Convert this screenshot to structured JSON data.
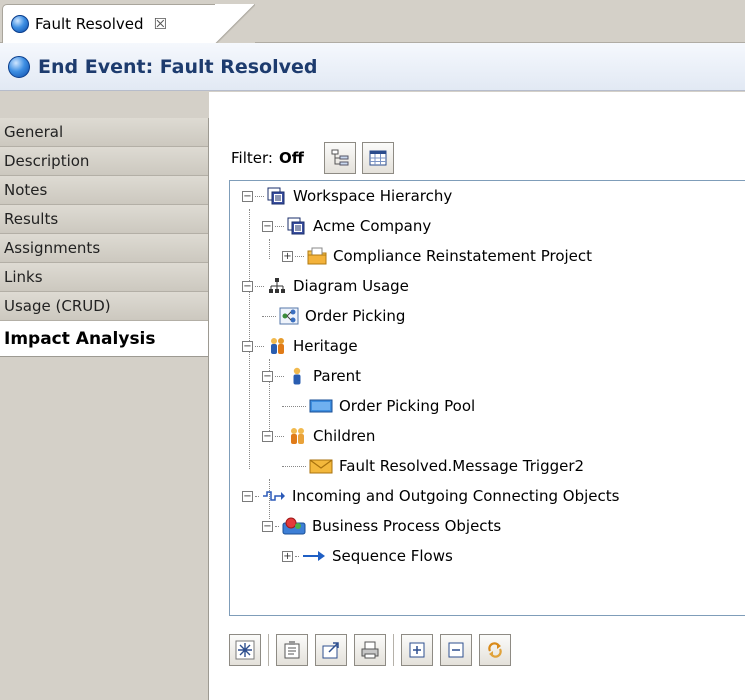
{
  "tab": {
    "label": "Fault Resolved",
    "close": "☒"
  },
  "title": "End Event: Fault Resolved",
  "nav": {
    "items": [
      {
        "label": "General"
      },
      {
        "label": "Description"
      },
      {
        "label": "Notes"
      },
      {
        "label": "Results"
      },
      {
        "label": "Assignments"
      },
      {
        "label": "Links"
      },
      {
        "label": "Usage (CRUD)"
      },
      {
        "label": "Impact Analysis",
        "active": true
      }
    ]
  },
  "filter": {
    "label": "Filter:",
    "value": "Off"
  },
  "tree": {
    "rows": [
      {
        "label": "Workspace Hierarchy",
        "icon": "workspace-icon",
        "expander": "minus"
      },
      {
        "label": "Acme Company",
        "icon": "company-icon",
        "expander": "minus"
      },
      {
        "label": "Compliance Reinstatement Project",
        "icon": "folder-icon",
        "expander": "plus"
      },
      {
        "label": "Diagram Usage",
        "icon": "hierarchy-icon",
        "expander": "minus"
      },
      {
        "label": "Order Picking",
        "icon": "diagram-icon"
      },
      {
        "label": "Heritage",
        "icon": "people-icon",
        "expander": "minus"
      },
      {
        "label": "Parent",
        "icon": "person-icon",
        "expander": "minus"
      },
      {
        "label": "Order Picking Pool",
        "icon": "pool-icon"
      },
      {
        "label": "Children",
        "icon": "people-icon",
        "expander": "minus"
      },
      {
        "label": "Fault Resolved.Message Trigger2",
        "icon": "envelope-icon"
      },
      {
        "label": "Incoming and Outgoing Connecting Objects",
        "icon": "connector-icon",
        "expander": "minus"
      },
      {
        "label": "Business Process Objects",
        "icon": "process-objects-icon",
        "expander": "minus"
      },
      {
        "label": "Sequence Flows",
        "icon": "arrow-right-icon",
        "expander": "plus"
      }
    ]
  },
  "colors": {
    "accent": "#1d3b6e",
    "tree_border": "#7f9db9",
    "panel": "#d4d0c8"
  }
}
